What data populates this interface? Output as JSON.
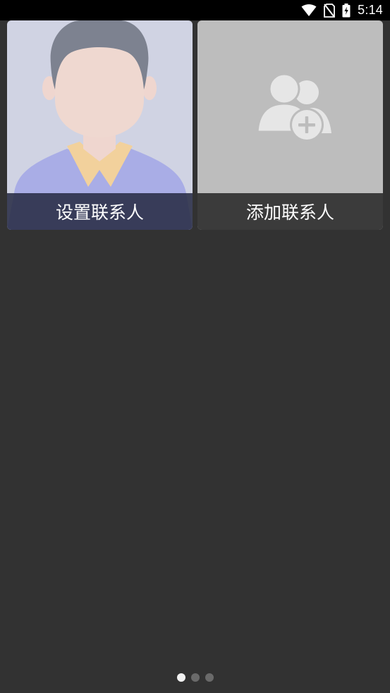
{
  "status_bar": {
    "time": "5:14",
    "icons": [
      "wifi-icon",
      "no-sim-icon",
      "battery-charging-icon"
    ]
  },
  "tiles": [
    {
      "label": "设置联系人",
      "icon": "person-avatar-icon"
    },
    {
      "label": "添加联系人",
      "icon": "add-contact-icon"
    }
  ],
  "pager": {
    "count": 3,
    "active_index": 0
  },
  "colors": {
    "background": "#323232",
    "status_bar": "#000000",
    "avatar_tile": "#d0d3e3",
    "add_tile": "#bdbdbd",
    "pager_active": "#f2f2f2",
    "pager_inactive": "#6a6a6a"
  }
}
